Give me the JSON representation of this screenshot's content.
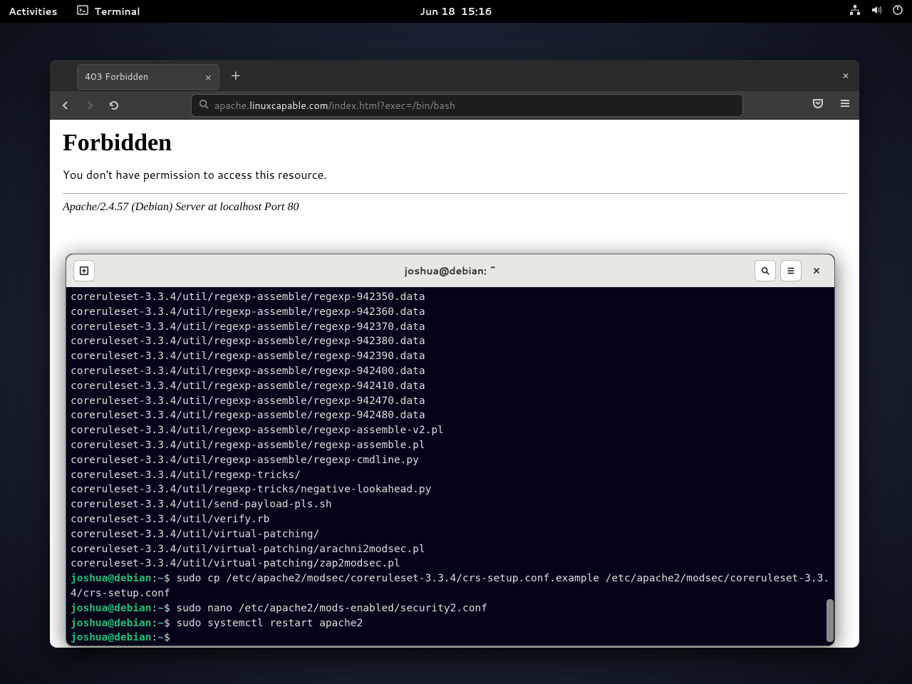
{
  "topbar": {
    "activities": "Activities",
    "terminal_label": "Terminal",
    "clock": "Jun 18  15:16"
  },
  "browser": {
    "tab_title": "403 Forbidden",
    "url_subdomain": "apache.",
    "url_domain": "linuxcapable.com",
    "url_path": "/index.html?exec=/bin/bash",
    "page": {
      "heading": "Forbidden",
      "message": "You don't have permission to access this resource.",
      "signature": "Apache/2.4.57 (Debian) Server at localhost Port 80"
    }
  },
  "terminal": {
    "title": "joshua@debian: ~",
    "prompt_user": "joshua@debian",
    "output_lines": [
      "coreruleset-3.3.4/util/regexp-assemble/regexp-942350.data",
      "coreruleset-3.3.4/util/regexp-assemble/regexp-942360.data",
      "coreruleset-3.3.4/util/regexp-assemble/regexp-942370.data",
      "coreruleset-3.3.4/util/regexp-assemble/regexp-942380.data",
      "coreruleset-3.3.4/util/regexp-assemble/regexp-942390.data",
      "coreruleset-3.3.4/util/regexp-assemble/regexp-942400.data",
      "coreruleset-3.3.4/util/regexp-assemble/regexp-942410.data",
      "coreruleset-3.3.4/util/regexp-assemble/regexp-942470.data",
      "coreruleset-3.3.4/util/regexp-assemble/regexp-942480.data",
      "coreruleset-3.3.4/util/regexp-assemble/regexp-assemble-v2.pl",
      "coreruleset-3.3.4/util/regexp-assemble/regexp-assemble.pl",
      "coreruleset-3.3.4/util/regexp-assemble/regexp-cmdline.py",
      "coreruleset-3.3.4/util/regexp-tricks/",
      "coreruleset-3.3.4/util/regexp-tricks/negative-lookahead.py",
      "coreruleset-3.3.4/util/send-payload-pls.sh",
      "coreruleset-3.3.4/util/verify.rb",
      "coreruleset-3.3.4/util/virtual-patching/",
      "coreruleset-3.3.4/util/virtual-patching/arachni2modsec.pl",
      "coreruleset-3.3.4/util/virtual-patching/zap2modsec.pl"
    ],
    "commands": [
      "sudo cp /etc/apache2/modsec/coreruleset-3.3.4/crs-setup.conf.example /etc/apache2/modsec/coreruleset-3.3.4/crs-setup.conf",
      "sudo nano /etc/apache2/mods-enabled/security2.conf",
      "sudo systemctl restart apache2",
      ""
    ]
  }
}
